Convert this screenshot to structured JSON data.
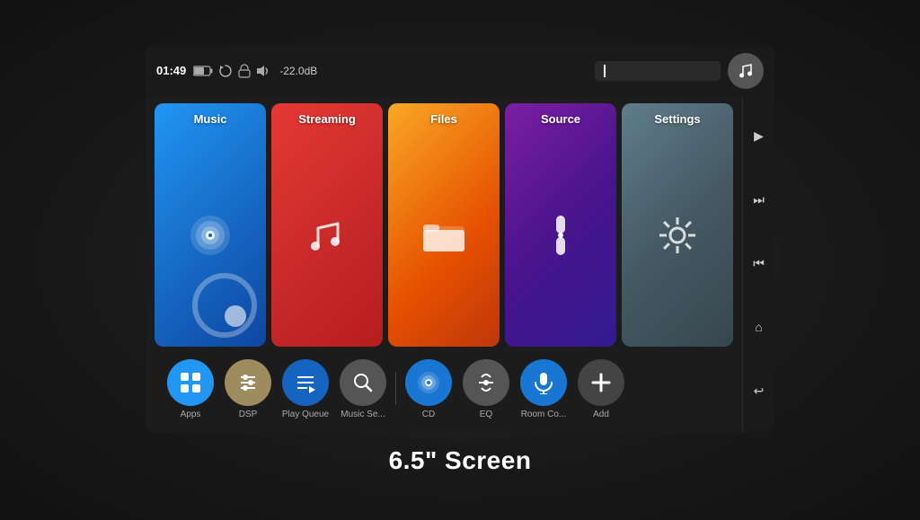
{
  "screen": {
    "title": "6.5\" Screen"
  },
  "statusBar": {
    "time": "01:49",
    "volume": "-22.0dB",
    "searchPlaceholder": ""
  },
  "tiles": [
    {
      "id": "music",
      "label": "Music",
      "colorClass": "tile-music"
    },
    {
      "id": "streaming",
      "label": "Streaming",
      "colorClass": "tile-streaming"
    },
    {
      "id": "files",
      "label": "Files",
      "colorClass": "tile-files"
    },
    {
      "id": "source",
      "label": "Source",
      "colorClass": "tile-source"
    },
    {
      "id": "settings",
      "label": "Settings",
      "colorClass": "tile-settings"
    }
  ],
  "shortcuts": [
    {
      "id": "apps",
      "label": "Apps",
      "btnClass": "btn-apps"
    },
    {
      "id": "dsp",
      "label": "DSP",
      "btnClass": "btn-dsp"
    },
    {
      "id": "playqueue",
      "label": "Play Queue",
      "btnClass": "btn-playqueue"
    },
    {
      "id": "musicse",
      "label": "Music Se...",
      "btnClass": "btn-musicse"
    },
    {
      "id": "cd",
      "label": "CD",
      "btnClass": "btn-cd"
    },
    {
      "id": "eq",
      "label": "EQ",
      "btnClass": "btn-eq"
    },
    {
      "id": "roomco",
      "label": "Room Co...",
      "btnClass": "btn-roomco"
    },
    {
      "id": "add",
      "label": "Add",
      "btnClass": "btn-add"
    }
  ],
  "verticalControls": [
    {
      "id": "play",
      "symbol": "▶"
    },
    {
      "id": "next",
      "symbol": "⏭"
    },
    {
      "id": "prev",
      "symbol": "⏮"
    },
    {
      "id": "home",
      "symbol": "⌂"
    },
    {
      "id": "back",
      "symbol": "↩"
    }
  ]
}
